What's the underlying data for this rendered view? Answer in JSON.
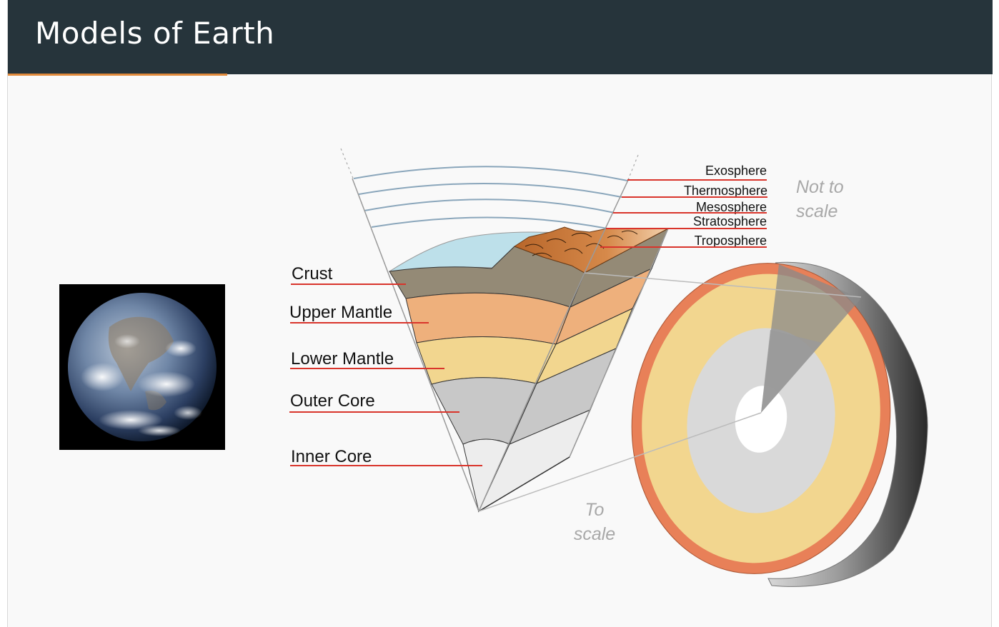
{
  "slide": {
    "title": "Models of Earth"
  },
  "images": {
    "earth_photo": "earth-photo"
  },
  "layers": [
    {
      "name": "Crust"
    },
    {
      "name": "Upper Mantle"
    },
    {
      "name": "Lower Mantle"
    },
    {
      "name": "Outer Core"
    },
    {
      "name": "Inner Core"
    }
  ],
  "atmosphere": [
    {
      "name": "Exosphere"
    },
    {
      "name": "Thermosphere"
    },
    {
      "name": "Mesosphere"
    },
    {
      "name": "Stratosphere"
    },
    {
      "name": "Troposphere"
    }
  ],
  "notes": {
    "not_to_scale_line1": "Not to",
    "not_to_scale_line2": "scale",
    "to_scale_line1": "To",
    "to_scale_line2": "scale"
  },
  "colors": {
    "header_bg": "#26343b",
    "accent": "#e0893a",
    "leader_line": "#d9342b",
    "crust": "#948a76",
    "upper_mantle": "#eeb07c",
    "lower_mantle": "#f2d68f",
    "outer_core": "#c8c8c8",
    "inner_core": "#ededed",
    "ocean": "#bde0ea",
    "mountains": "#c87b3b"
  }
}
